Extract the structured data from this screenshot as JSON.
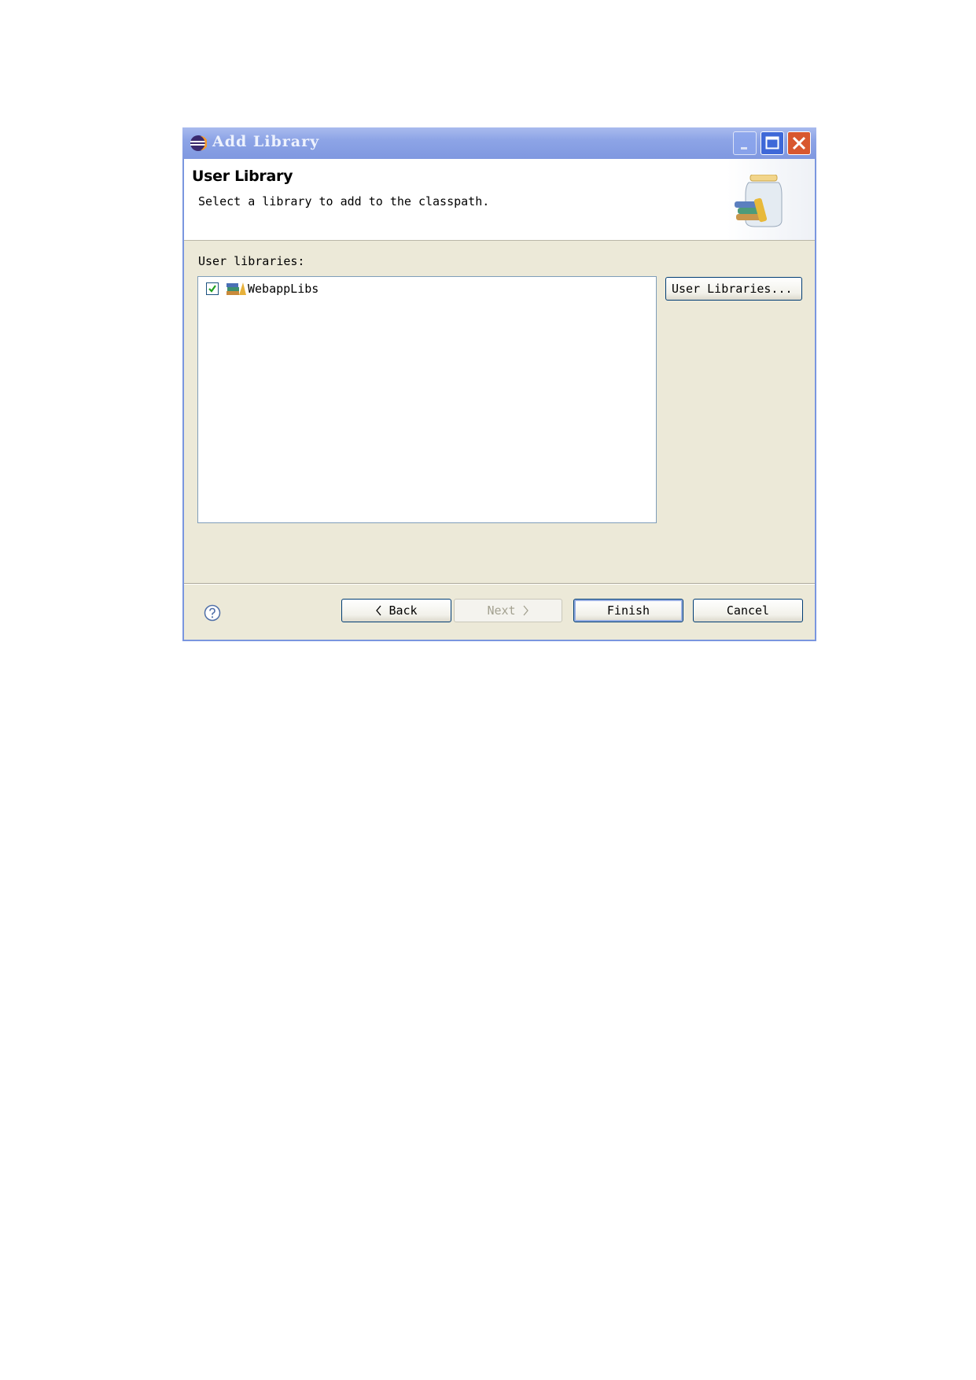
{
  "window": {
    "title": "Add Library"
  },
  "header": {
    "title": "User Library",
    "description": "Select a library to add to the classpath."
  },
  "libraries": {
    "label": "User libraries:",
    "items": [
      {
        "label": "WebappLibs",
        "checked": true
      }
    ]
  },
  "buttons": {
    "user_libraries": "User Libraries...",
    "back": "Back",
    "next": "Next",
    "finish": "Finish",
    "cancel": "Cancel"
  },
  "icons": {
    "app": "eclipse-icon",
    "wizard": "library-jar-icon",
    "help": "help-icon"
  },
  "colors": {
    "titlebar": "#7f98e0",
    "dialog_bg": "#ece9d8",
    "close_button": "#d8572f"
  }
}
